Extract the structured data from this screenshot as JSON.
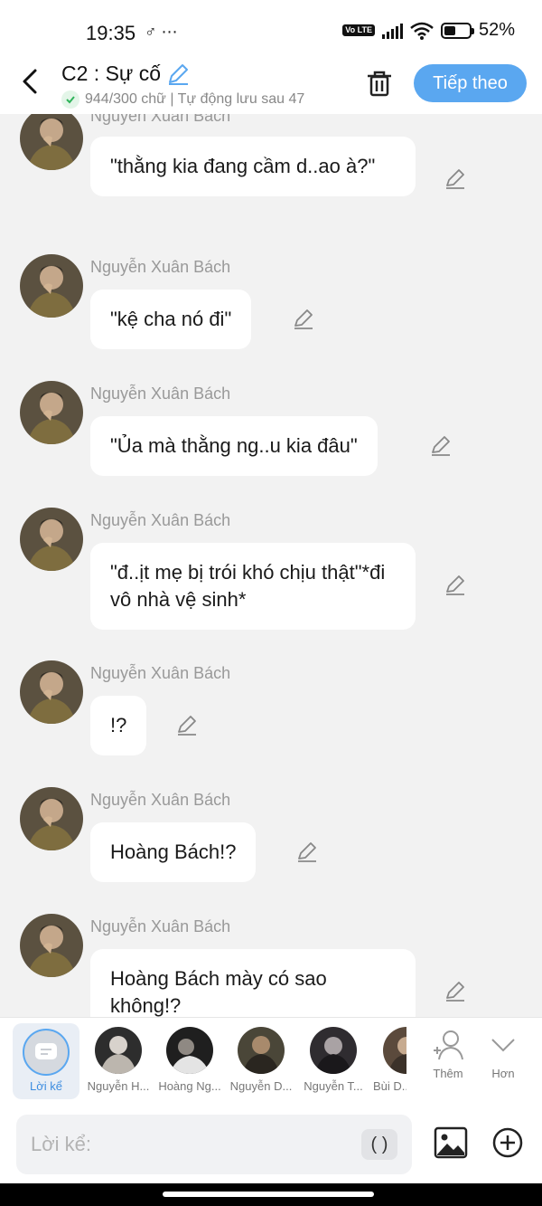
{
  "status_bar": {
    "time": "19:35",
    "left_icons": "♂ ⋯",
    "volte": "Vo LTE",
    "battery": "52%"
  },
  "header": {
    "title": "C2 : Sự cố",
    "subtitle": "944/300 chữ | Tự động lưu sau 47",
    "next_label": "Tiếp theo"
  },
  "messages": [
    {
      "name": "Nguyễn Xuân Bách",
      "text": "\"thằng kia đang cầm d..ao à?\""
    },
    {
      "name": "Nguyễn Xuân Bách",
      "text": "\"kệ cha nó đi\""
    },
    {
      "name": "Nguyễn Xuân Bách",
      "text": "\"Ủa mà thằng ng..u kia đâu\""
    },
    {
      "name": "Nguyễn Xuân Bách",
      "text": "\"đ..ịt mẹ bị trói khó chịu thật\"*đi vô nhà vệ sinh*"
    },
    {
      "name": "Nguyễn Xuân Bách",
      "text": "!?"
    },
    {
      "name": "Nguyễn Xuân Bách",
      "text": "Hoàng Bách!?"
    },
    {
      "name": "Nguyễn Xuân Bách",
      "text": "Hoàng Bách mày có sao không!?"
    }
  ],
  "characters": {
    "narration_label": "Lời kể",
    "items": [
      {
        "label": "Nguyễn H..."
      },
      {
        "label": "Hoàng Ng..."
      },
      {
        "label": "Nguyễn D..."
      },
      {
        "label": "Nguyễn T..."
      },
      {
        "label": "Bùi D..."
      }
    ],
    "add_label": "Thêm",
    "more_label": "Hơn"
  },
  "input": {
    "placeholder": "Lời kể:",
    "paren_label": "( )"
  },
  "colors": {
    "accent": "#5aa7f0",
    "bubble": "#ffffff",
    "background": "#f2f2f2"
  }
}
